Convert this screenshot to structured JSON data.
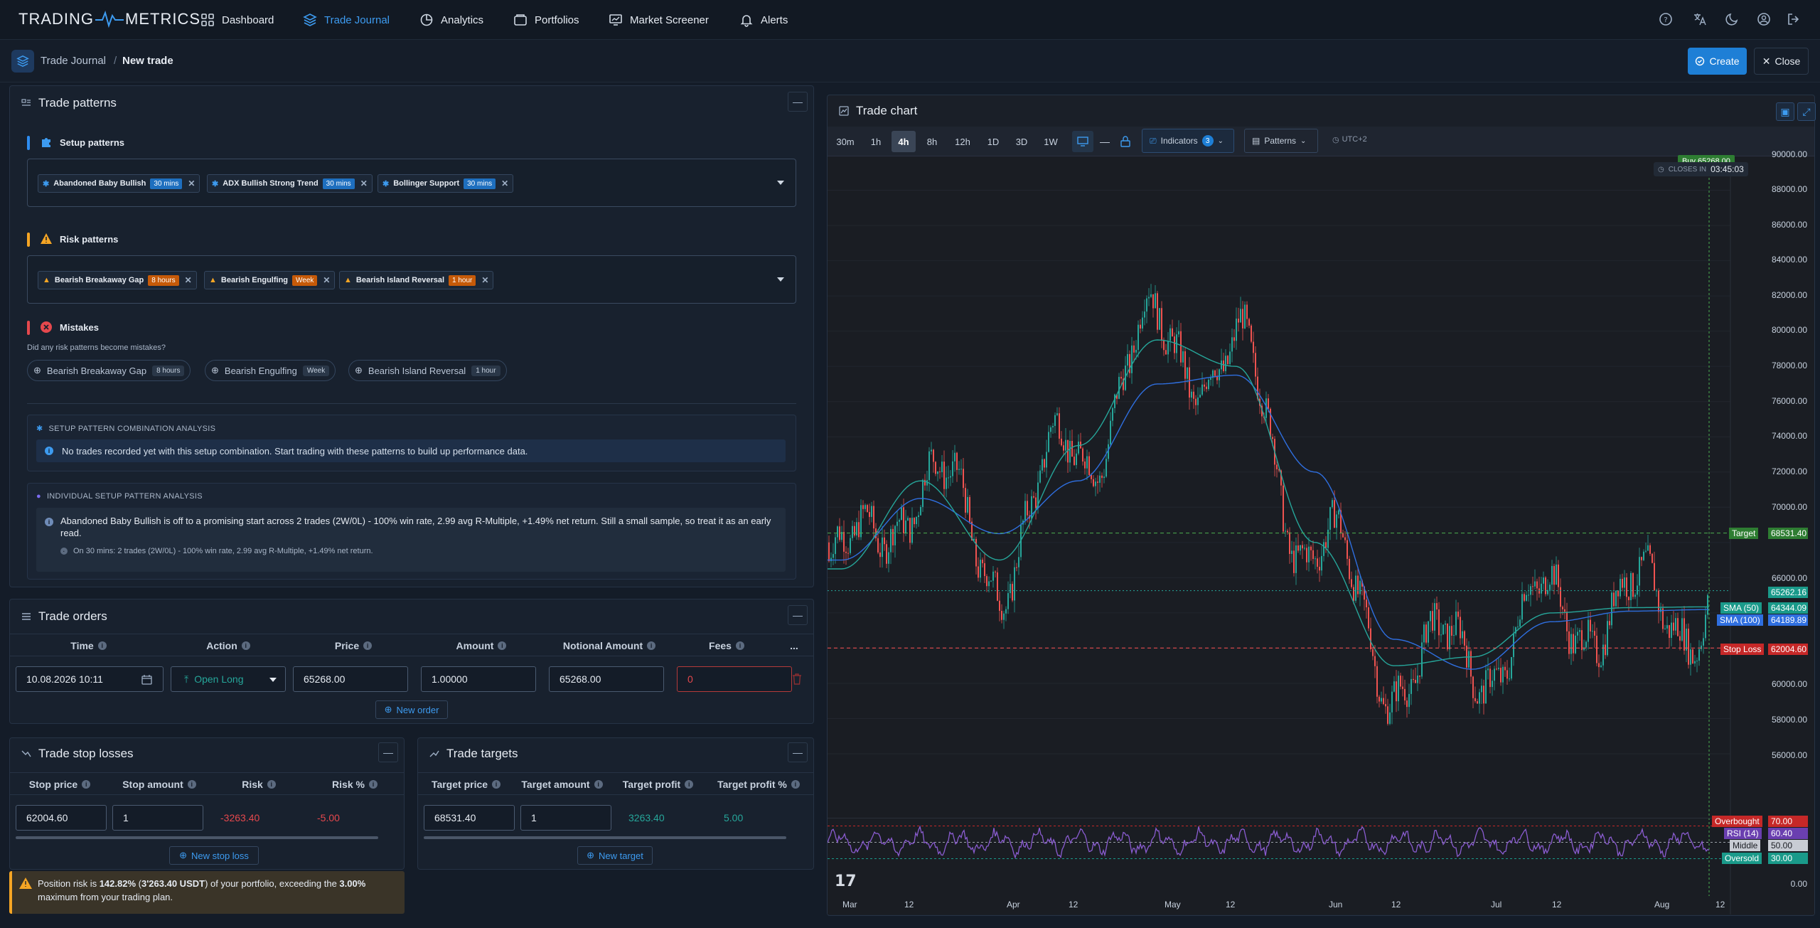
{
  "brand": {
    "left": "TRADING",
    "right": "METRICS"
  },
  "nav": [
    {
      "label": "Dashboard",
      "icon": "grid-icon"
    },
    {
      "label": "Trade Journal",
      "icon": "layers-icon",
      "active": true
    },
    {
      "label": "Analytics",
      "icon": "pie-chart-icon"
    },
    {
      "label": "Portfolios",
      "icon": "wallet-icon"
    },
    {
      "label": "Market Screener",
      "icon": "screener-icon"
    },
    {
      "label": "Alerts",
      "icon": "bell-icon"
    }
  ],
  "breadcrumb": {
    "parent": "Trade Journal",
    "separator": "/",
    "current": "New trade"
  },
  "actions": {
    "create": "Create",
    "close": "Close"
  },
  "patterns": {
    "title": "Trade patterns",
    "setup": {
      "label": "Setup patterns",
      "chips": [
        {
          "name": "Abandoned Baby Bullish",
          "tag": "30 mins"
        },
        {
          "name": "ADX Bullish Strong Trend",
          "tag": "30 mins"
        },
        {
          "name": "Bollinger Support",
          "tag": "30 mins"
        }
      ]
    },
    "risk": {
      "label": "Risk patterns",
      "chips": [
        {
          "name": "Bearish Breakaway Gap",
          "tag": "8 hours"
        },
        {
          "name": "Bearish Engulfing",
          "tag": "Week"
        },
        {
          "name": "Bearish Island Reversal",
          "tag": "1 hour"
        }
      ]
    },
    "mistakes": {
      "label": "Mistakes",
      "question": "Did any risk patterns become mistakes?",
      "pills": [
        {
          "name": "Bearish Breakaway Gap",
          "tag": "8 hours"
        },
        {
          "name": "Bearish Engulfing",
          "tag": "Week"
        },
        {
          "name": "Bearish Island Reversal",
          "tag": "1 hour"
        }
      ]
    },
    "combo": {
      "title": "SETUP PATTERN COMBINATION ANALYSIS",
      "message": "No trades recorded yet with this setup combination. Start trading with these patterns to build up performance data."
    },
    "individual": {
      "title": "INDIVIDUAL SETUP PATTERN ANALYSIS",
      "message": "Abandoned Baby Bullish is off to a promising start across 2 trades (2W/0L) - 100% win rate, 2.99 avg R-Multiple, +1.49% net return. Still a small sample, so treat it as an early read.",
      "detail": "On 30 mins: 2 trades (2W/0L) - 100% win rate, 2.99 avg R-Multiple, +1.49% net return."
    }
  },
  "orders": {
    "title": "Trade orders",
    "columns": [
      "Time",
      "Action",
      "Price",
      "Amount",
      "Notional Amount",
      "Fees"
    ],
    "more": "...",
    "row": {
      "time": "10.08.2026 10:11",
      "action": "Open Long",
      "price": "65268.00",
      "amount": "1.00000",
      "notional": "65268.00",
      "fees": "0"
    },
    "new_label": "New order"
  },
  "stops": {
    "title": "Trade stop losses",
    "columns": [
      "Stop price",
      "Stop amount",
      "Risk",
      "Risk %"
    ],
    "row": {
      "price": "62004.60",
      "amount": "1",
      "risk": "-3263.40",
      "risk_pct": "-5.00"
    },
    "new_label": "New stop loss",
    "warning": {
      "a": "Position risk is ",
      "pct": "142.82%",
      "b": " (",
      "usd": "3'263.40 USDT",
      "c": ") of your portfolio, exceeding the ",
      "max": "3.00%",
      "d": " maximum from your trading plan."
    }
  },
  "targets": {
    "title": "Trade targets",
    "columns": [
      "Target price",
      "Target amount",
      "Target profit",
      "Target profit %"
    ],
    "row": {
      "price": "68531.40",
      "amount": "1",
      "profit": "3263.40",
      "profit_pct": "5.00"
    },
    "new_label": "New target"
  },
  "chart": {
    "title": "Trade chart",
    "timeframes": [
      "30m",
      "1h",
      "4h",
      "8h",
      "12h",
      "1D",
      "3D",
      "1W"
    ],
    "active_timeframe": "4h",
    "indicators_label": "Indicators",
    "indicators_count": "3",
    "patterns_label": "Patterns",
    "timezone": "UTC+2",
    "buy_label": "Buy 65268.00",
    "closes_in_label": "CLOSES IN",
    "closes_in_value": "03:45:03",
    "price_axis": [
      "90000.00",
      "88000.00",
      "86000.00",
      "84000.00",
      "82000.00",
      "80000.00",
      "78000.00",
      "76000.00",
      "74000.00",
      "72000.00",
      "70000.00",
      "66000.00",
      "60000.00",
      "58000.00",
      "56000.00",
      "0.00"
    ],
    "labels": {
      "target": {
        "name": "Target",
        "value": "68531.40"
      },
      "current": {
        "value": "65262.16"
      },
      "sma50": {
        "name": "SMA (50)",
        "value": "64344.09"
      },
      "sma100": {
        "name": "SMA (100)",
        "value": "64189.89"
      },
      "stop": {
        "name": "Stop Loss",
        "value": "62004.60"
      },
      "overbought": {
        "name": "Overbought",
        "value": "70.00"
      },
      "rsi": {
        "name": "RSI (14)",
        "value": "60.40"
      },
      "middle": {
        "name": "Middle",
        "value": "50.00"
      },
      "oversold": {
        "name": "Oversold",
        "value": "30.00"
      }
    },
    "x_axis": [
      "Mar",
      "12",
      "Apr",
      "12",
      "May",
      "12",
      "Jun",
      "12",
      "Jul",
      "12",
      "Aug",
      "12"
    ],
    "colors": {
      "up": "#26a69a",
      "down": "#ef5350",
      "sma50": "#26a69a",
      "sma100": "#2f6fe0",
      "rsi": "#8a5cd0",
      "target": "#4caf50",
      "stop": "#e53935"
    }
  },
  "chart_data": {
    "type": "line",
    "title": "",
    "xlabel": "",
    "ylabel": "",
    "x": [
      "Mar",
      "12",
      "Apr",
      "12",
      "May",
      "12",
      "Jun",
      "12",
      "Jul",
      "12",
      "Aug",
      "12"
    ],
    "series": [
      {
        "name": "SMA (50)",
        "values": [
          66500,
          71500,
          67000,
          73500,
          79500,
          78000,
          68000,
          61000,
          61500,
          64000,
          64300,
          64344
        ]
      },
      {
        "name": "SMA (100)",
        "values": [
          67000,
          70500,
          68500,
          71500,
          77000,
          77500,
          72000,
          62500,
          60800,
          63500,
          64100,
          64190
        ]
      }
    ],
    "ylim": [
      52000,
      90000
    ]
  }
}
